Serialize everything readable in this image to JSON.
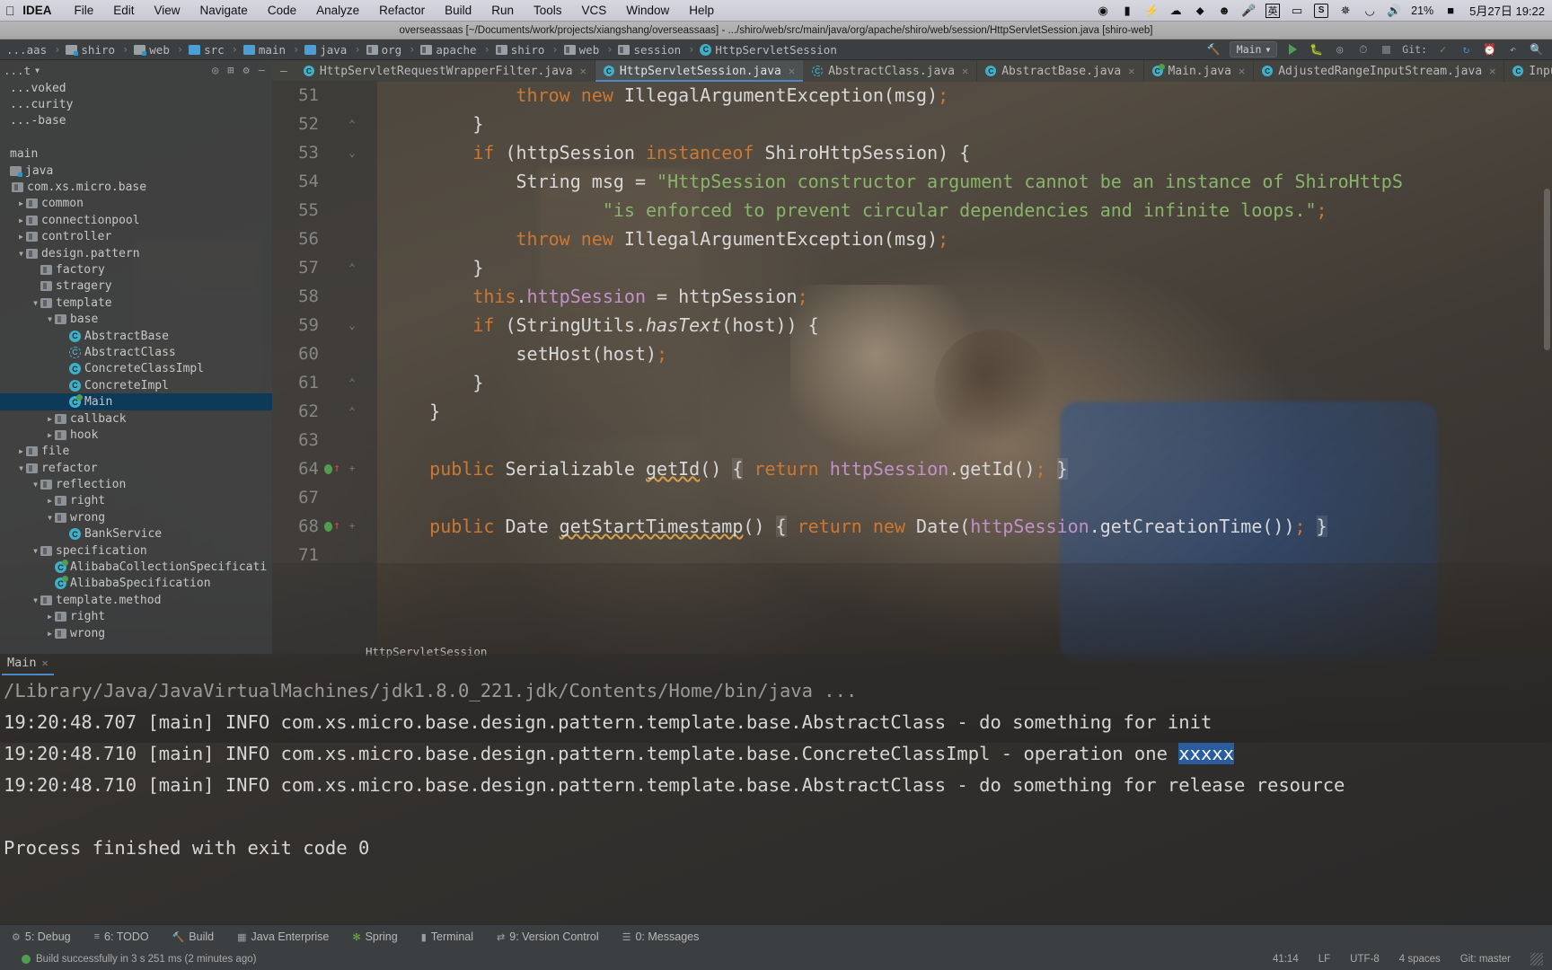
{
  "macbar": {
    "apple": "",
    "app_name": "IDEA",
    "menus": [
      "File",
      "Edit",
      "View",
      "Navigate",
      "Code",
      "Analyze",
      "Refactor",
      "Build",
      "Run",
      "Tools",
      "VCS",
      "Window",
      "Help"
    ],
    "status_icons": [
      "record-icon",
      "bookmark-icon",
      "bolt-icon",
      "cloud-icon",
      "shield-icon",
      "clock-smile-icon",
      "microphone-icon",
      "input-source-chinese-icon",
      "airplay-icon",
      "snipaste-icon",
      "bluetooth-icon",
      "wifi-icon",
      "volume-icon"
    ],
    "input_source_label": "英",
    "battery_percent": "21%",
    "datetime": "5月27日 19:22"
  },
  "window": {
    "title": "overseassaas [~/Documents/work/projects/xiangshang/overseassaas] - .../shiro/web/src/main/java/org/apache/shiro/web/session/HttpServletSession.java [shiro-web]"
  },
  "navbar": {
    "crumbs": [
      {
        "label": "...aas",
        "icon": "folder-icon"
      },
      {
        "label": "shiro",
        "icon": "source-folder-icon"
      },
      {
        "label": "web",
        "icon": "source-folder-icon"
      },
      {
        "label": "src",
        "icon": "folder-blue-icon"
      },
      {
        "label": "main",
        "icon": "folder-blue-icon"
      },
      {
        "label": "java",
        "icon": "folder-blue-icon"
      },
      {
        "label": "org",
        "icon": "package-icon"
      },
      {
        "label": "apache",
        "icon": "package-icon"
      },
      {
        "label": "shiro",
        "icon": "package-icon"
      },
      {
        "label": "web",
        "icon": "package-icon"
      },
      {
        "label": "session",
        "icon": "package-icon"
      },
      {
        "label": "HttpServletSession",
        "icon": "class-icon"
      }
    ],
    "run_config": "Main",
    "git_label": "Git:",
    "buttons": [
      "run-button",
      "debug-button",
      "coverage-button",
      "profile-button",
      "stop-button",
      "git-update-button",
      "git-commit-button",
      "git-history-button",
      "git-rollback-button",
      "search-button"
    ]
  },
  "editor_tabs": [
    {
      "label": "HttpServletRequestWrapperFilter.java",
      "active": false,
      "icon": "class-icon"
    },
    {
      "label": "HttpServletSession.java",
      "active": true,
      "icon": "class-icon"
    },
    {
      "label": "AbstractClass.java",
      "active": false,
      "icon": "abstract-class-icon"
    },
    {
      "label": "AbstractBase.java",
      "active": false,
      "icon": "class-icon"
    },
    {
      "label": "Main.java",
      "active": false,
      "icon": "runnable-class-icon"
    },
    {
      "label": "AdjustedRangeInputStream.java",
      "active": false,
      "icon": "class-icon"
    },
    {
      "label": "InputStream.java",
      "active": false,
      "icon": "class-icon"
    }
  ],
  "sidebar": {
    "title": "Project",
    "header_icons": [
      "locate-icon",
      "collapse-all-icon",
      "settings-gear-icon",
      "hide-icon"
    ],
    "tree": [
      {
        "label": "...voked",
        "depth": 0,
        "arrow": "",
        "icon": "none",
        "selected": false,
        "clipped": true
      },
      {
        "label": "...curity",
        "depth": 0,
        "arrow": "",
        "icon": "none",
        "selected": false,
        "clipped": true
      },
      {
        "label": "...-base",
        "depth": 0,
        "arrow": "",
        "icon": "none",
        "selected": false,
        "clipped": true
      },
      {
        "label": "",
        "depth": 0,
        "arrow": "",
        "icon": "none",
        "selected": false,
        "clipped": true
      },
      {
        "label": "main",
        "depth": 0,
        "arrow": "",
        "icon": "none",
        "selected": false,
        "clipped": true
      },
      {
        "label": "java",
        "depth": 0,
        "arrow": "",
        "icon": "source-folder-icon",
        "selected": false,
        "clipped": true
      },
      {
        "label": "com.xs.micro.base",
        "depth": 1,
        "arrow": "",
        "icon": "package-icon",
        "selected": false
      },
      {
        "label": "common",
        "depth": 2,
        "arrow": "collapsed",
        "icon": "package-icon",
        "selected": false
      },
      {
        "label": "connectionpool",
        "depth": 2,
        "arrow": "collapsed",
        "icon": "package-icon",
        "selected": false
      },
      {
        "label": "controller",
        "depth": 2,
        "arrow": "collapsed",
        "icon": "package-icon",
        "selected": false
      },
      {
        "label": "design.pattern",
        "depth": 2,
        "arrow": "expanded",
        "icon": "package-icon",
        "selected": false
      },
      {
        "label": "factory",
        "depth": 3,
        "arrow": "none",
        "icon": "package-icon",
        "selected": false
      },
      {
        "label": "stragery",
        "depth": 3,
        "arrow": "none",
        "icon": "package-icon",
        "selected": false
      },
      {
        "label": "template",
        "depth": 3,
        "arrow": "expanded",
        "icon": "package-icon",
        "selected": false
      },
      {
        "label": "base",
        "depth": 4,
        "arrow": "expanded",
        "icon": "package-icon",
        "selected": false
      },
      {
        "label": "AbstractBase",
        "depth": 5,
        "arrow": "none",
        "icon": "class-icon",
        "selected": false
      },
      {
        "label": "AbstractClass",
        "depth": 5,
        "arrow": "none",
        "icon": "abstract-class-icon",
        "selected": false
      },
      {
        "label": "ConcreteClassImpl",
        "depth": 5,
        "arrow": "none",
        "icon": "class-icon",
        "selected": false
      },
      {
        "label": "ConcreteImpl",
        "depth": 5,
        "arrow": "none",
        "icon": "class-icon",
        "selected": false
      },
      {
        "label": "Main",
        "depth": 5,
        "arrow": "none",
        "icon": "runnable-class-icon",
        "selected": true
      },
      {
        "label": "callback",
        "depth": 4,
        "arrow": "collapsed",
        "icon": "package-icon",
        "selected": false
      },
      {
        "label": "hook",
        "depth": 4,
        "arrow": "collapsed",
        "icon": "package-icon",
        "selected": false
      },
      {
        "label": "file",
        "depth": 2,
        "arrow": "collapsed",
        "icon": "package-icon",
        "selected": false
      },
      {
        "label": "refactor",
        "depth": 2,
        "arrow": "expanded",
        "icon": "package-icon",
        "selected": false
      },
      {
        "label": "reflection",
        "depth": 3,
        "arrow": "expanded",
        "icon": "package-icon",
        "selected": false
      },
      {
        "label": "right",
        "depth": 4,
        "arrow": "collapsed",
        "icon": "package-icon",
        "selected": false
      },
      {
        "label": "wrong",
        "depth": 4,
        "arrow": "expanded",
        "icon": "package-icon",
        "selected": false
      },
      {
        "label": "BankService",
        "depth": 5,
        "arrow": "none",
        "icon": "class-icon",
        "selected": false
      },
      {
        "label": "specification",
        "depth": 3,
        "arrow": "expanded",
        "icon": "package-icon",
        "selected": false
      },
      {
        "label": "AlibabaCollectionSpecificati",
        "depth": 4,
        "arrow": "none",
        "icon": "runnable-class-icon",
        "selected": false
      },
      {
        "label": "AlibabaSpecification",
        "depth": 4,
        "arrow": "none",
        "icon": "runnable-class-icon",
        "selected": false
      },
      {
        "label": "template.method",
        "depth": 3,
        "arrow": "expanded",
        "icon": "package-icon",
        "selected": false
      },
      {
        "label": "right",
        "depth": 4,
        "arrow": "collapsed",
        "icon": "package-icon",
        "selected": false
      },
      {
        "label": "wrong",
        "depth": 4,
        "arrow": "collapsed",
        "icon": "package-icon",
        "selected": false
      }
    ]
  },
  "code": {
    "breadcrumb": "HttpServletSession",
    "lines": [
      {
        "num": "51",
        "fold": "",
        "mark": "",
        "tokens": [
          {
            "t": "            ",
            "c": "plain"
          },
          {
            "t": "throw",
            "c": "kw"
          },
          {
            "t": " ",
            "c": "plain"
          },
          {
            "t": "new",
            "c": "kw"
          },
          {
            "t": " IllegalArgumentException(msg)",
            "c": "plain"
          },
          {
            "t": ";",
            "c": "kw"
          }
        ]
      },
      {
        "num": "52",
        "fold": "minus",
        "mark": "",
        "tokens": [
          {
            "t": "        }",
            "c": "plain"
          }
        ]
      },
      {
        "num": "53",
        "fold": "plus-down",
        "mark": "",
        "tokens": [
          {
            "t": "        ",
            "c": "plain"
          },
          {
            "t": "if",
            "c": "kw"
          },
          {
            "t": " (httpSession ",
            "c": "plain"
          },
          {
            "t": "instanceof",
            "c": "kw"
          },
          {
            "t": " ShiroHttpSession) {",
            "c": "plain"
          }
        ]
      },
      {
        "num": "54",
        "fold": "",
        "mark": "",
        "tokens": [
          {
            "t": "            String msg = ",
            "c": "plain"
          },
          {
            "t": "\"HttpSession constructor argument cannot be an instance of ShiroHttpS",
            "c": "str"
          }
        ]
      },
      {
        "num": "55",
        "fold": "",
        "mark": "",
        "tokens": [
          {
            "t": "                    ",
            "c": "plain"
          },
          {
            "t": "\"is enforced to prevent circular dependencies and infinite loops.\"",
            "c": "str"
          },
          {
            "t": ";",
            "c": "kw"
          }
        ]
      },
      {
        "num": "56",
        "fold": "",
        "mark": "",
        "tokens": [
          {
            "t": "            ",
            "c": "plain"
          },
          {
            "t": "throw",
            "c": "kw"
          },
          {
            "t": " ",
            "c": "plain"
          },
          {
            "t": "new",
            "c": "kw"
          },
          {
            "t": " IllegalArgumentException(msg)",
            "c": "plain"
          },
          {
            "t": ";",
            "c": "kw"
          }
        ]
      },
      {
        "num": "57",
        "fold": "minus",
        "mark": "",
        "tokens": [
          {
            "t": "        }",
            "c": "plain"
          }
        ]
      },
      {
        "num": "58",
        "fold": "",
        "mark": "",
        "tokens": [
          {
            "t": "        ",
            "c": "plain"
          },
          {
            "t": "this",
            "c": "kw"
          },
          {
            "t": ".",
            "c": "plain"
          },
          {
            "t": "httpSession",
            "c": "fld"
          },
          {
            "t": " = httpSession",
            "c": "plain"
          },
          {
            "t": ";",
            "c": "kw"
          }
        ]
      },
      {
        "num": "59",
        "fold": "plus-down",
        "mark": "",
        "tokens": [
          {
            "t": "        ",
            "c": "plain"
          },
          {
            "t": "if",
            "c": "kw"
          },
          {
            "t": " (StringUtils.",
            "c": "plain"
          },
          {
            "t": "hasText",
            "c": "ital"
          },
          {
            "t": "(host)) {",
            "c": "plain"
          }
        ]
      },
      {
        "num": "60",
        "fold": "",
        "mark": "",
        "tokens": [
          {
            "t": "            setHost(host)",
            "c": "plain"
          },
          {
            "t": ";",
            "c": "kw"
          }
        ]
      },
      {
        "num": "61",
        "fold": "minus",
        "mark": "",
        "tokens": [
          {
            "t": "        }",
            "c": "plain"
          }
        ]
      },
      {
        "num": "62",
        "fold": "minus",
        "mark": "",
        "tokens": [
          {
            "t": "    }",
            "c": "plain"
          }
        ]
      },
      {
        "num": "63",
        "fold": "",
        "mark": "",
        "tokens": []
      },
      {
        "num": "64",
        "fold": "plus",
        "mark": "override",
        "tokens": [
          {
            "t": "    ",
            "c": "plain"
          },
          {
            "t": "public",
            "c": "kw"
          },
          {
            "t": " Serializable ",
            "c": "plain"
          },
          {
            "t": "getId",
            "c": "warnu"
          },
          {
            "t": "() ",
            "c": "plain"
          },
          {
            "t": "{",
            "c": "brace"
          },
          {
            "t": " ",
            "c": "plain"
          },
          {
            "t": "return",
            "c": "kw"
          },
          {
            "t": " ",
            "c": "plain"
          },
          {
            "t": "httpSession",
            "c": "fld"
          },
          {
            "t": ".getId()",
            "c": "plain"
          },
          {
            "t": ";",
            "c": "kw"
          },
          {
            "t": " ",
            "c": "plain"
          },
          {
            "t": "}",
            "c": "brace"
          }
        ]
      },
      {
        "num": "67",
        "fold": "",
        "mark": "",
        "tokens": []
      },
      {
        "num": "68",
        "fold": "plus",
        "mark": "override",
        "tokens": [
          {
            "t": "    ",
            "c": "plain"
          },
          {
            "t": "public",
            "c": "kw"
          },
          {
            "t": " Date ",
            "c": "plain"
          },
          {
            "t": "getStartTimestamp",
            "c": "warnu"
          },
          {
            "t": "() ",
            "c": "plain"
          },
          {
            "t": "{",
            "c": "brace"
          },
          {
            "t": " ",
            "c": "plain"
          },
          {
            "t": "return",
            "c": "kw"
          },
          {
            "t": " ",
            "c": "plain"
          },
          {
            "t": "new",
            "c": "kw"
          },
          {
            "t": " Date(",
            "c": "plain"
          },
          {
            "t": "httpSession",
            "c": "fld"
          },
          {
            "t": ".getCreationTime())",
            "c": "plain"
          },
          {
            "t": ";",
            "c": "kw"
          },
          {
            "t": " ",
            "c": "plain"
          },
          {
            "t": "}",
            "c": "brace"
          }
        ]
      },
      {
        "num": "71",
        "fold": "",
        "mark": "",
        "tokens": []
      }
    ]
  },
  "run_panel": {
    "tab_label": "Main",
    "console_lines": [
      {
        "text": "/Library/Java/JavaVirtualMachines/jdk1.8.0_221.jdk/Contents/Home/bin/java ...",
        "style": "dim"
      },
      {
        "text": "19:20:48.707 [main] INFO com.xs.micro.base.design.pattern.template.base.AbstractClass - do something for init",
        "style": "normal"
      },
      {
        "text": "19:20:48.710 [main] INFO com.xs.micro.base.design.pattern.template.base.ConcreteClassImpl - operation one ",
        "style": "normal",
        "selected_suffix": "xxxxx"
      },
      {
        "text": "19:20:48.710 [main] INFO com.xs.micro.base.design.pattern.template.base.AbstractClass - do something for release resource",
        "style": "normal"
      },
      {
        "text": "",
        "style": "normal"
      },
      {
        "text": "Process finished with exit code 0",
        "style": "normal"
      }
    ]
  },
  "statusbar": {
    "items": [
      {
        "label": "5: Debug",
        "icon": "debug-icon"
      },
      {
        "label": "6: TODO",
        "icon": "todo-icon"
      },
      {
        "label": "Build",
        "icon": "build-icon"
      },
      {
        "label": "Java Enterprise",
        "icon": "java-ee-icon"
      },
      {
        "label": "Spring",
        "icon": "spring-icon"
      },
      {
        "label": "Terminal",
        "icon": "terminal-icon"
      },
      {
        "label": "9: Version Control",
        "icon": "vcs-icon"
      },
      {
        "label": "0: Messages",
        "icon": "messages-icon"
      }
    ]
  },
  "bottombar": {
    "message": "Build successfully in 3 s 251 ms (2 minutes ago)",
    "caret": "41:14",
    "line_separator": "LF",
    "encoding": "UTF-8",
    "indent": "4 spaces",
    "git_branch": "Git: master"
  }
}
